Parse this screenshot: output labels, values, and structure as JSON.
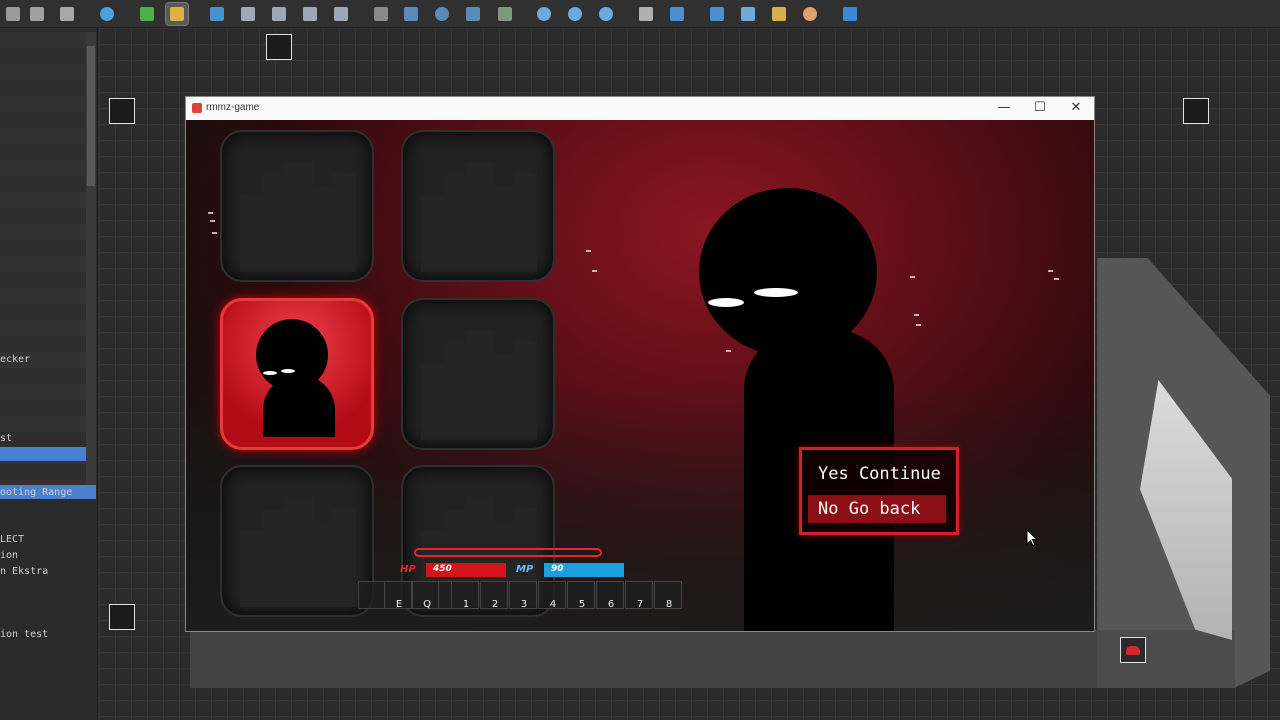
{
  "editor": {
    "toolbar_icons": [
      "cut-icon",
      "copy-icon",
      "paste-icon",
      "undo-icon",
      "map-mode-icon",
      "event-mode-icon",
      "layer1-icon",
      "layer2-icon",
      "layer3-icon",
      "layer4-icon",
      "layer5-icon",
      "pencil-icon",
      "rectangle-icon",
      "ellipse-icon",
      "flood-fill-icon",
      "shadow-pen-icon",
      "zoom-in-icon",
      "zoom-out-icon",
      "zoom-actual-icon",
      "database-icon",
      "plugin-icon",
      "sound-icon",
      "resource-icon",
      "event-search-icon",
      "character-generator-icon",
      "playtest-icon"
    ],
    "sidebar_items": [
      "ecker",
      "st",
      "ooting Range",
      "LECT",
      "ion",
      "n Ekstra",
      "ion test"
    ]
  },
  "game_window": {
    "title": "rmmz-game",
    "minimize": "—",
    "maximize": "☐",
    "close": "✕"
  },
  "choice_menu": {
    "options": [
      "Yes Continue",
      "No Go back"
    ],
    "selected": 1
  },
  "hud": {
    "hp_label": "HP",
    "hp_value": "450",
    "mp_label": "MP",
    "mp_value": "90",
    "hotkeys": [
      "",
      "E",
      "Q",
      "",
      "1",
      "2",
      "3",
      "4",
      "5",
      "6",
      "7",
      "8"
    ]
  },
  "colors": {
    "accent": "#d0202a",
    "hp": "#d5141c",
    "mp": "#1b9fe0",
    "selection": "#4a7fd0"
  }
}
